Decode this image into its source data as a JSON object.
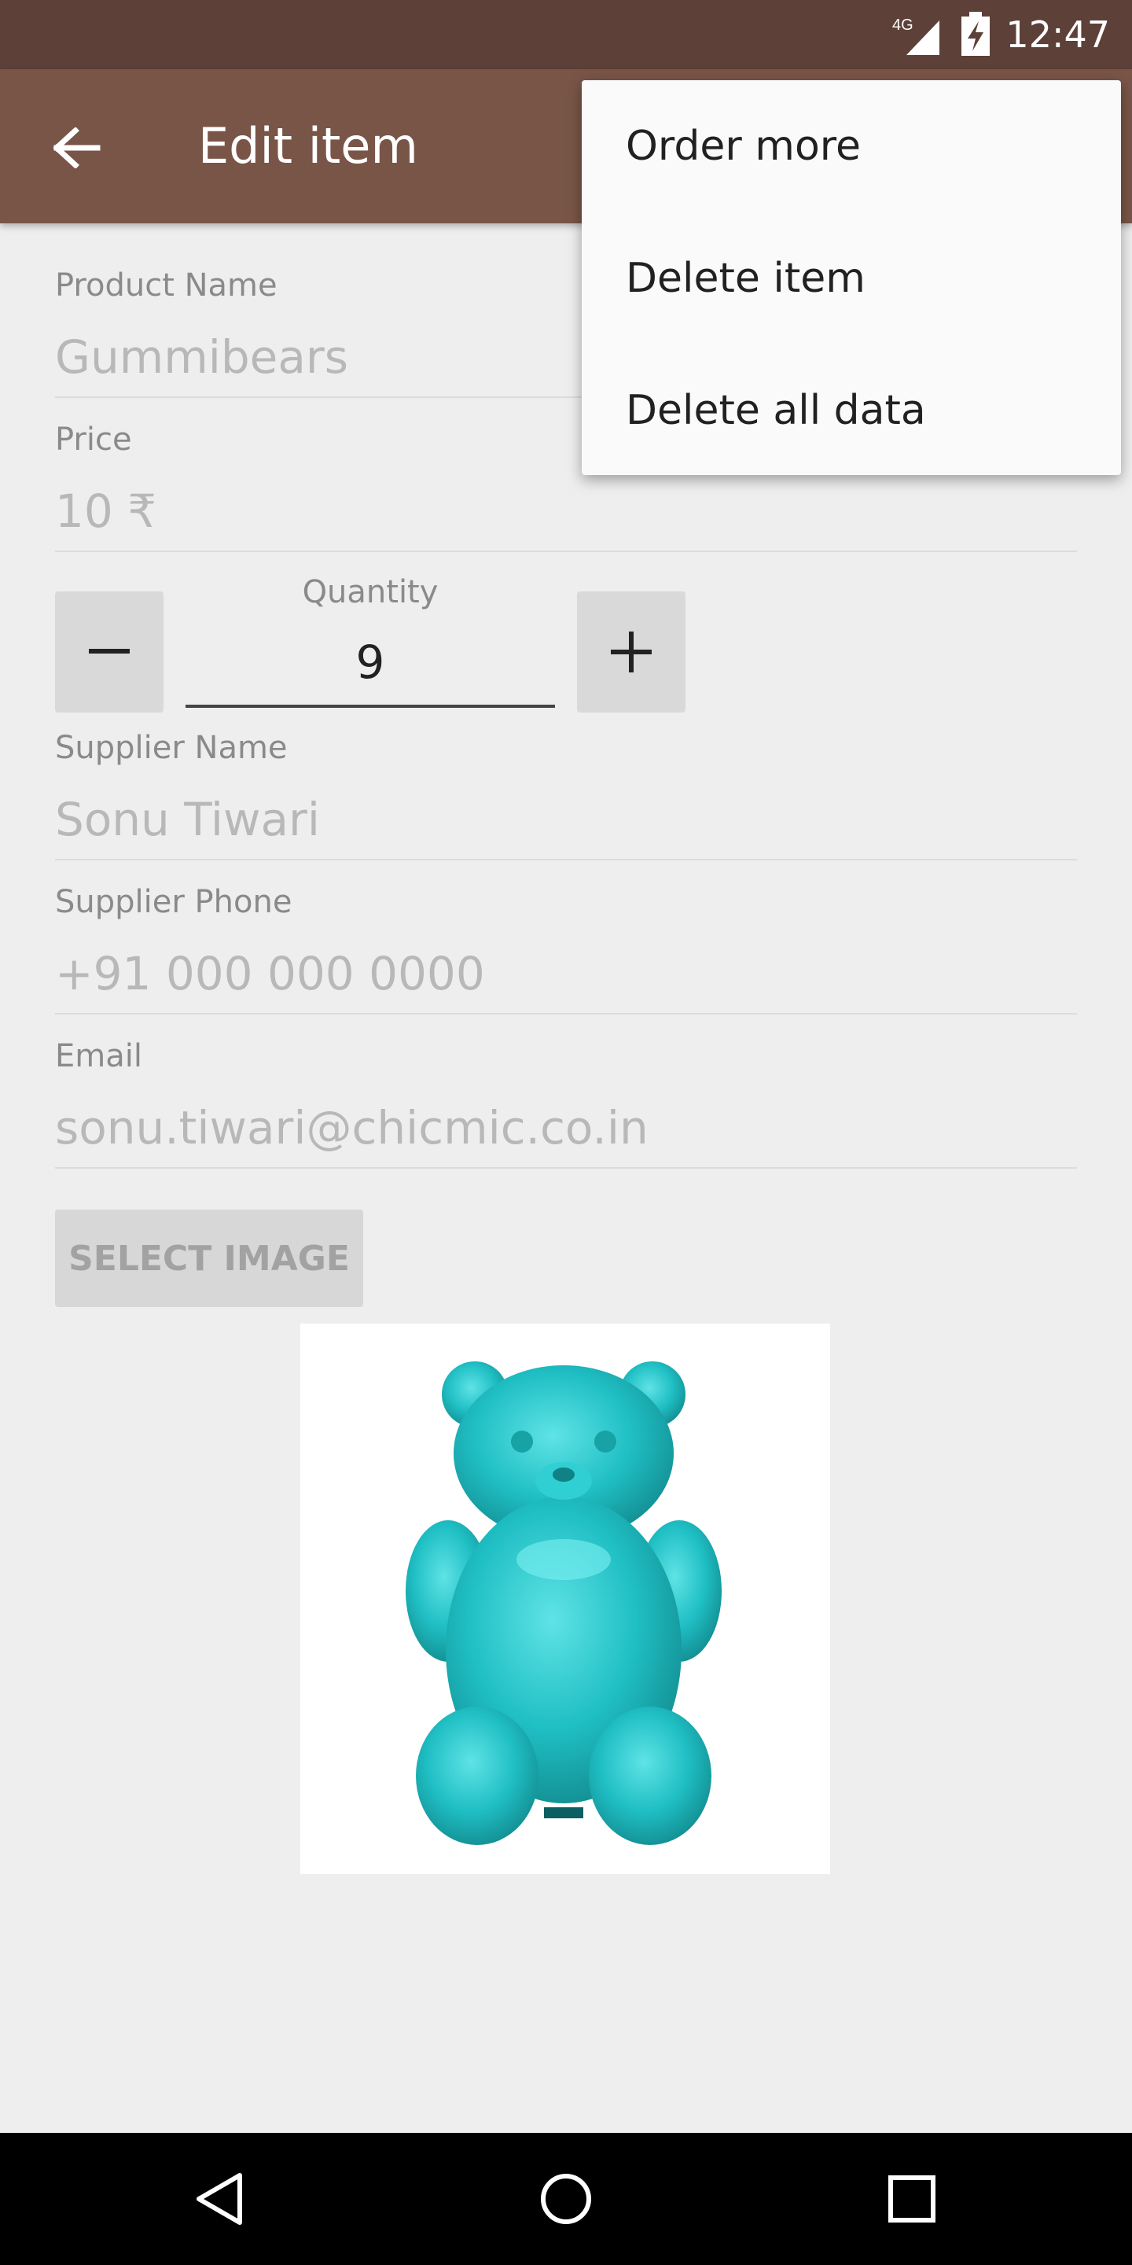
{
  "status_bar": {
    "network": "4G",
    "time": "12:47",
    "icons": [
      "signal-icon",
      "battery-icon"
    ]
  },
  "app_bar": {
    "title": "Edit item",
    "back_icon": "arrow-back-icon"
  },
  "form": {
    "product_name": {
      "label": "Product Name",
      "value": "Gummibears"
    },
    "price": {
      "label": "Price",
      "value": "10 ₹"
    },
    "quantity": {
      "label": "Quantity",
      "value": "9",
      "decrement": "−",
      "increment": "+"
    },
    "supplier_name": {
      "label": "Supplier Name",
      "value": "Sonu Tiwari"
    },
    "supplier_phone": {
      "label": "Supplier Phone",
      "value": "+91 000 000 0000"
    },
    "email": {
      "label": "Email",
      "value": "sonu.tiwari@chicmic.co.in"
    },
    "select_image_label": "SELECT IMAGE"
  },
  "image": {
    "subject": "gummy-bear-image",
    "color": "#1fbfc4"
  },
  "overflow_menu": {
    "items": [
      "Order more",
      "Delete item",
      "Delete all data"
    ]
  },
  "nav_bar": {
    "icons": [
      "back-triangle-icon",
      "home-circle-icon",
      "recents-square-icon"
    ]
  },
  "colors": {
    "status_bar": "#5d4037",
    "app_bar": "#795548",
    "background": "#eeeeee",
    "menu": "#fafafa"
  }
}
